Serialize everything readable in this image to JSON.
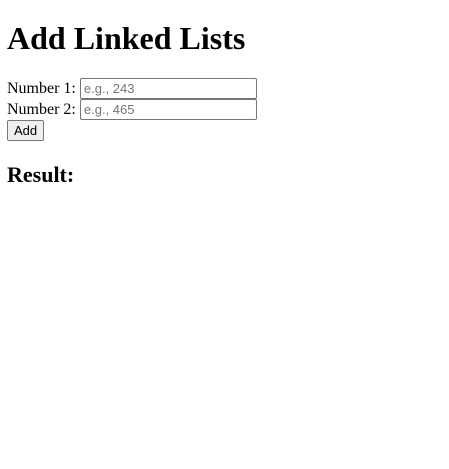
{
  "page": {
    "title": "Add Linked Lists"
  },
  "form": {
    "number1": {
      "label": "Number 1:",
      "value": "",
      "placeholder": "e.g., 243"
    },
    "number2": {
      "label": "Number 2:",
      "value": "",
      "placeholder": "e.g., 465"
    },
    "add_label": "Add"
  },
  "result": {
    "heading": "Result:"
  }
}
